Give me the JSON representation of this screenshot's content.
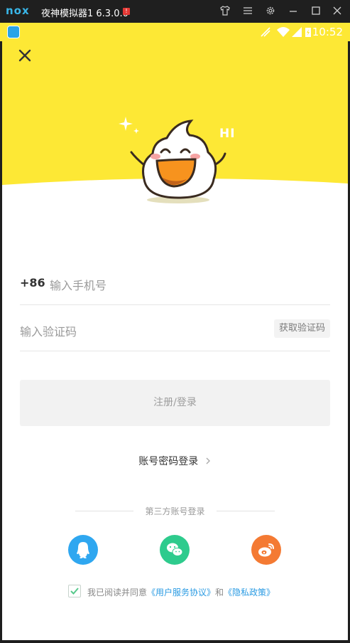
{
  "emulator": {
    "logo": "nox",
    "title": "夜神模拟器1 6.3.0.0",
    "alert": "!",
    "icons": [
      "shirt-icon",
      "menu-icon",
      "gear-icon",
      "minimize-icon",
      "maximize-icon",
      "close-icon"
    ]
  },
  "status_bar": {
    "time": "10:52",
    "icons": [
      "no-signal-icon",
      "wifi-icon",
      "signal-icon",
      "battery-charging-icon"
    ]
  },
  "header": {
    "bubble_text": "HI"
  },
  "form": {
    "country_code": "+86",
    "phone_placeholder": "输入手机号",
    "code_placeholder": "输入验证码",
    "get_code_label": "获取验证码",
    "submit_label": "注册/登录",
    "password_login_label": "账号密码登录"
  },
  "third_party": {
    "label": "第三方账号登录",
    "providers": [
      {
        "name": "QQ",
        "color": "#2fa7f0"
      },
      {
        "name": "WeChat",
        "color": "#2ecb8d"
      },
      {
        "name": "Weibo",
        "color": "#f47a33"
      }
    ]
  },
  "agreement": {
    "checked": true,
    "prefix": "我已阅读并同意",
    "terms": "《用户服务协议》",
    "and": "和",
    "privacy": "《隐私政策》"
  },
  "colors": {
    "brand_yellow": "#fde835",
    "link_blue": "#2a9be3"
  }
}
